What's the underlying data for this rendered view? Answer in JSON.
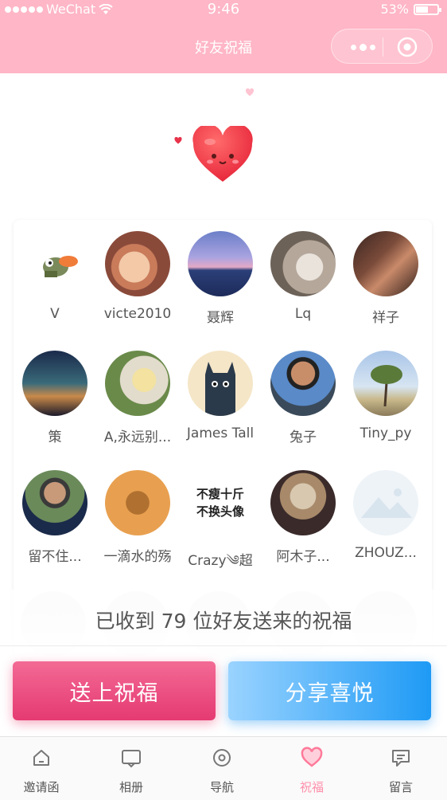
{
  "status_bar": {
    "carrier": "WeChat",
    "time": "9:46",
    "battery": "53%",
    "battery_level": 0.53
  },
  "nav": {
    "title": "好友祝福"
  },
  "friends": [
    {
      "name": "V"
    },
    {
      "name": "victe2010"
    },
    {
      "name": "聂辉"
    },
    {
      "name": "Lq"
    },
    {
      "name": "祥子"
    },
    {
      "name": "策"
    },
    {
      "name": "A,永远别..."
    },
    {
      "name": "James Tall"
    },
    {
      "name": "兔子"
    },
    {
      "name": "Tiny_py"
    },
    {
      "name": "留不住..."
    },
    {
      "name": "一滴水的殇"
    },
    {
      "name": "Crazy༄超"
    },
    {
      "name": "阿木子..."
    },
    {
      "name": "ZHOUZ..."
    }
  ],
  "avatar_texts": {
    "crazy_line1": "不瘦十斤",
    "crazy_line2": "不换头像"
  },
  "summary": {
    "prefix": "已收到",
    "count": "79",
    "suffix": "位好友送来的祝福"
  },
  "buttons": {
    "bless": "送上祝福",
    "share": "分享喜悦"
  },
  "tabs": [
    {
      "label": "邀请函",
      "icon": "home-icon"
    },
    {
      "label": "相册",
      "icon": "album-icon"
    },
    {
      "label": "导航",
      "icon": "location-icon"
    },
    {
      "label": "祝福",
      "icon": "heart-icon",
      "active": true
    },
    {
      "label": "留言",
      "icon": "message-icon"
    }
  ],
  "colors": {
    "header": "#ffb6c6",
    "bless_button": "#e94679",
    "share_button": "#1e9af5",
    "active_tab": "#ff8fab"
  }
}
